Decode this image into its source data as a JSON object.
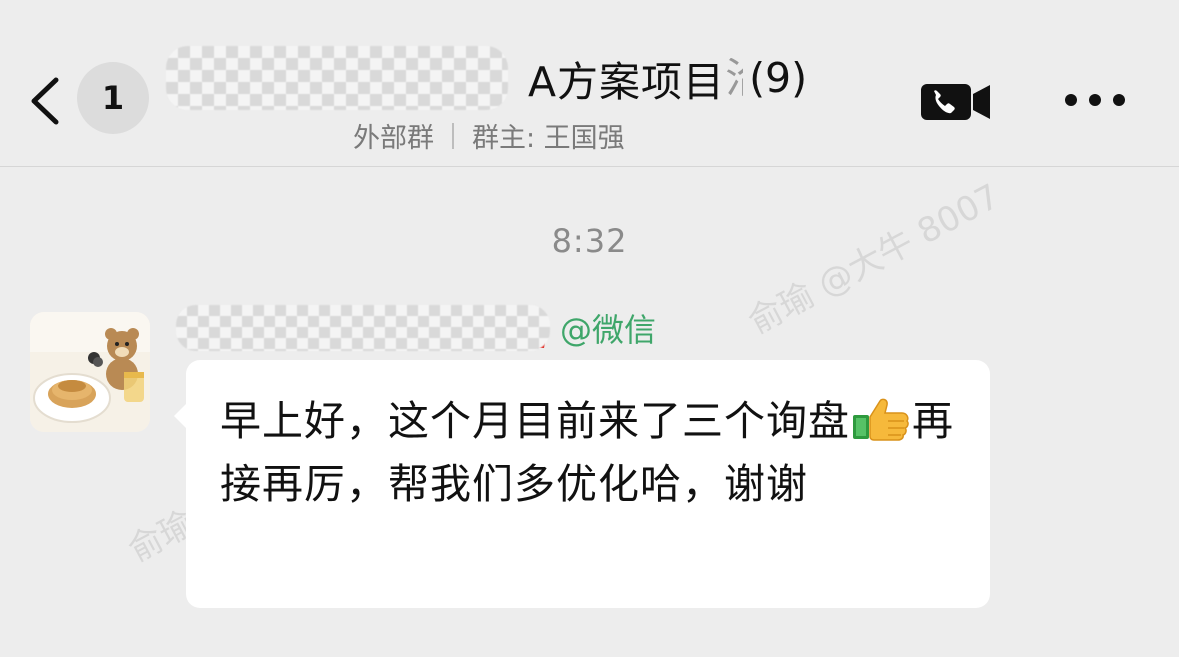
{
  "header": {
    "unread_count": "1",
    "title_visible": "A方案项目",
    "title_cut_char": "洽",
    "member_count": "(9)",
    "group_type": "外部群",
    "owner": "群主: 王国强"
  },
  "chat": {
    "timestamp": "8:32",
    "watermark": "俞瑜 @大牛 8007",
    "watermark_partial": "俞瑜",
    "messages": [
      {
        "sender_source": "@微信",
        "text_before_emoji": "早上好，这个月目前来了三个询盘",
        "emoji": "thumbs-up",
        "text_after_emoji": "再接再厉，帮我们多优化哈，谢谢"
      }
    ]
  },
  "colors": {
    "background": "#ededed",
    "bubble": "#ffffff",
    "wechat_green": "#3fa66a"
  }
}
